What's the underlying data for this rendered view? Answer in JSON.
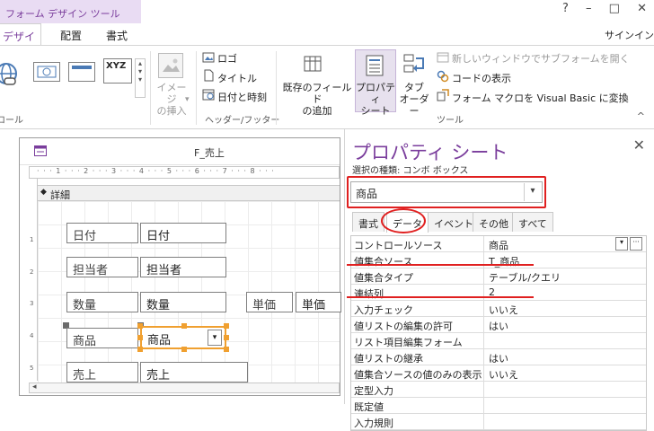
{
  "app": {
    "context_tab": "フォーム デザイン ツール",
    "window_controls": [
      "?",
      "–",
      "□",
      "✕"
    ],
    "signin": "サインイン"
  },
  "tabs": [
    {
      "label": "デザイン",
      "active": true
    },
    {
      "label": "配置",
      "active": false
    },
    {
      "label": "書式",
      "active": false
    }
  ],
  "ribbon": {
    "controls_group_label": "ロール",
    "insert_image_label": "イメージ\nの挿入",
    "insert_image_arrow": "▾",
    "header_footer": {
      "logo": "ロゴ",
      "title": "タイトル",
      "datetime": "日付と時刻",
      "group_label": "ヘッダー/フッター"
    },
    "tools": {
      "add_existing_fields": "既存のフィールド\nの追加",
      "property_sheet": "プロパティ\nシート",
      "tab_order": "タブ\nオーダー",
      "subform_new_window": "新しいウィンドウでサブフォームを開く",
      "view_code": "コードの表示",
      "convert_macros": "フォーム マクロを Visual Basic に変換",
      "group_label": "ツール"
    },
    "collapse": "^"
  },
  "form": {
    "title": "F_売上",
    "ruler": "· · · 1 · · · 2 · · · 3 · · · 4 · · · 5 · · · 6 · · · 7 · · · 8 · · ·",
    "section_label": "詳細",
    "fields": [
      {
        "label": "日付",
        "value": "日付"
      },
      {
        "label": "担当者",
        "value": "担当者"
      },
      {
        "label": "数量",
        "value": "数量"
      },
      {
        "label": "単価",
        "value": "単価"
      },
      {
        "label": "商品",
        "value": "商品"
      },
      {
        "label": "売上",
        "value": "売上"
      }
    ],
    "vruler_marks": [
      "1",
      "2",
      "3",
      "4",
      "5"
    ]
  },
  "property_sheet": {
    "title": "プロパティ シート",
    "selection_kind": "選択の種類: コンボ ボックス",
    "selected_control": "商品",
    "tabs": [
      "書式",
      "データ",
      "イベント",
      "その他",
      "すべて"
    ],
    "active_tab": "データ",
    "rows": [
      {
        "name": "コントロールソース",
        "value": "商品"
      },
      {
        "name": "値集合ソース",
        "value": "T_商品"
      },
      {
        "name": "値集合タイプ",
        "value": "テーブル/クエリ"
      },
      {
        "name": "連結列",
        "value": "2"
      },
      {
        "name": "入力チェック",
        "value": "いいえ"
      },
      {
        "name": "値リストの編集の許可",
        "value": "はい"
      },
      {
        "name": "リスト項目編集フォーム",
        "value": ""
      },
      {
        "name": "値リストの継承",
        "value": "はい"
      },
      {
        "name": "値集合ソースの値のみの表示",
        "value": "いいえ"
      },
      {
        "name": "定型入力",
        "value": ""
      },
      {
        "name": "既定値",
        "value": ""
      },
      {
        "name": "入力規則",
        "value": ""
      }
    ]
  },
  "colors": {
    "accent": "#7a3d9c",
    "annotation": "#e02020",
    "selection": "#f0a030"
  }
}
